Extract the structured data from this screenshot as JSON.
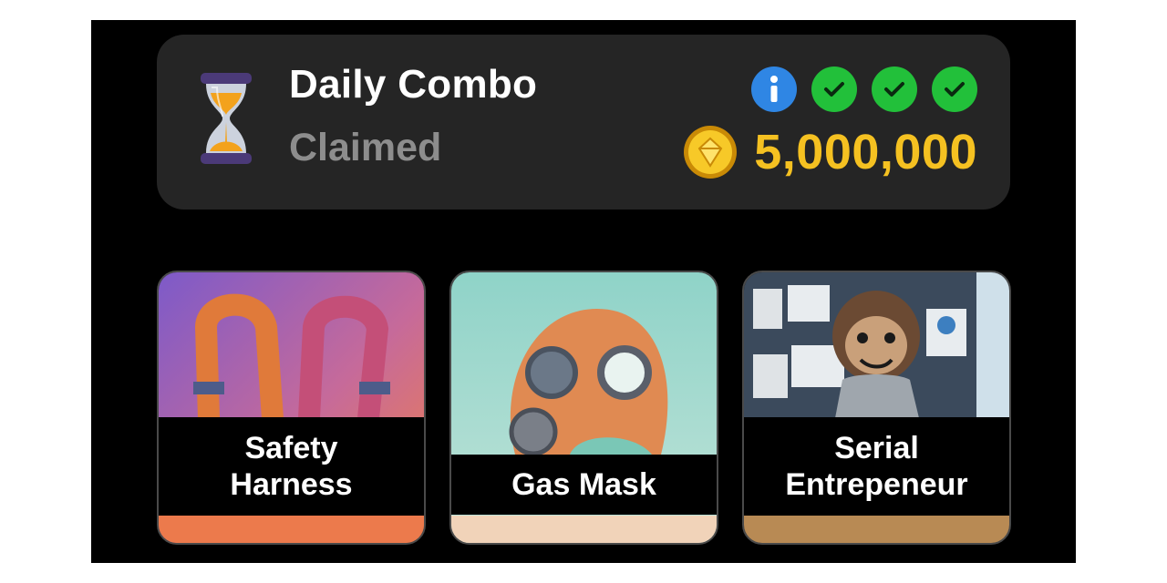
{
  "daily_combo": {
    "title": "Daily Combo",
    "status": "Claimed",
    "reward": "5,000,000",
    "indicators": [
      {
        "type": "info",
        "icon": "info-icon",
        "color": "#2f86e4"
      },
      {
        "type": "done",
        "icon": "check-icon",
        "color": "#22c03a"
      },
      {
        "type": "done",
        "icon": "check-icon",
        "color": "#22c03a"
      },
      {
        "type": "done",
        "icon": "check-icon",
        "color": "#22c03a"
      }
    ],
    "reward_icon": "gold-coin-icon",
    "title_icon": "hourglass-icon"
  },
  "cards": [
    {
      "line1": "Safety",
      "line2": "Harness",
      "art": "safety-harness-image"
    },
    {
      "line1": "Gas Mask",
      "art": "gas-mask-image"
    },
    {
      "line1": "Serial",
      "line2": "Entrepeneur",
      "art": "serial-entrepreneur-image"
    }
  ],
  "colors": {
    "panel": "#252525",
    "reward_text": "#f5c121",
    "status_text": "#8d8d8d",
    "background": "#000000"
  }
}
